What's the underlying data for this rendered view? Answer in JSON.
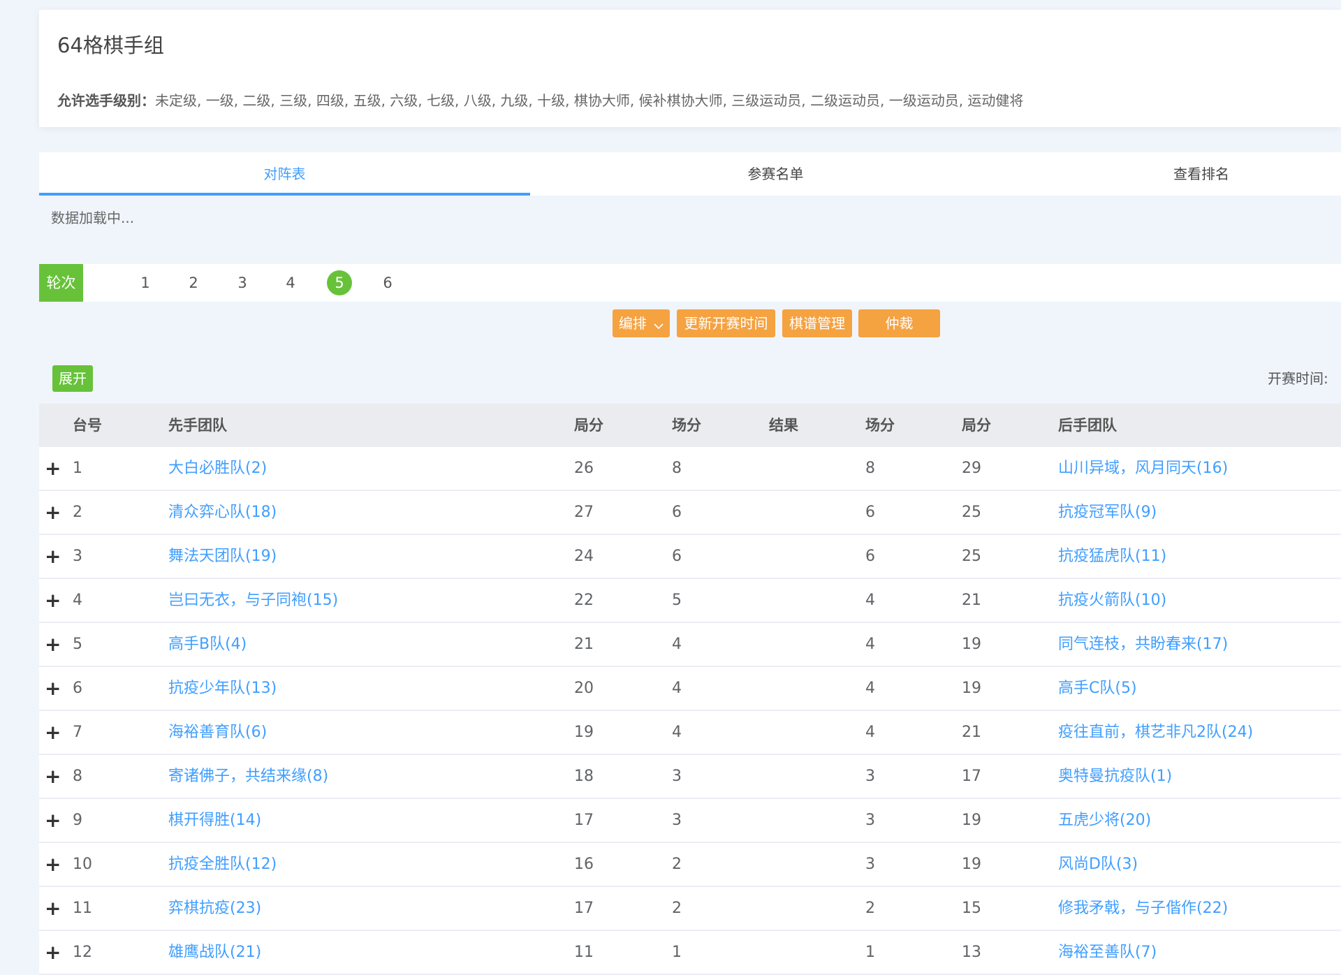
{
  "header": {
    "title": "64格棋手组",
    "grades_label": "允许选手级别：",
    "grades_value": "未定级, 一级, 二级, 三级, 四级, 五级, 六级, 七级, 八级, 九级, 十级, 棋协大师, 候补棋协大师, 三级运动员, 二级运动员, 一级运动员, 运动健将"
  },
  "tabs": [
    {
      "label": "对阵表",
      "active": true
    },
    {
      "label": "参赛名单",
      "active": false
    },
    {
      "label": "查看排名",
      "active": false
    }
  ],
  "loading_text": "数据加载中...",
  "rounds": {
    "label": "轮次",
    "items": [
      "1",
      "2",
      "3",
      "4",
      "5",
      "6"
    ],
    "active": "5"
  },
  "actions": {
    "arrange": "编排",
    "update_time": "更新开赛时间",
    "record_manage": "棋谱管理",
    "arbitrate": "仲裁"
  },
  "expand_label": "展开",
  "start_time_label": "开赛时间:",
  "table": {
    "headers": {
      "no": "台号",
      "home": "先手团队",
      "home_game_score": "局分",
      "home_match_score": "场分",
      "result": "结果",
      "away_match_score": "场分",
      "away_game_score": "局分",
      "away": "后手团队"
    },
    "rows": [
      {
        "no": "1",
        "home": "大白必胜队(2)",
        "hgs": "26",
        "hms": "8",
        "res": "",
        "ams": "8",
        "ags": "29",
        "away": "山川异域，风月同天(16)"
      },
      {
        "no": "2",
        "home": "清众弈心队(18)",
        "hgs": "27",
        "hms": "6",
        "res": "",
        "ams": "6",
        "ags": "25",
        "away": "抗疫冠军队(9)"
      },
      {
        "no": "3",
        "home": "舞法天团队(19)",
        "hgs": "24",
        "hms": "6",
        "res": "",
        "ams": "6",
        "ags": "25",
        "away": "抗疫猛虎队(11)"
      },
      {
        "no": "4",
        "home": "岂曰无衣，与子同袍(15)",
        "hgs": "22",
        "hms": "5",
        "res": "",
        "ams": "4",
        "ags": "21",
        "away": "抗疫火箭队(10)"
      },
      {
        "no": "5",
        "home": "高手B队(4)",
        "hgs": "21",
        "hms": "4",
        "res": "",
        "ams": "4",
        "ags": "19",
        "away": "同气连枝，共盼春来(17)"
      },
      {
        "no": "6",
        "home": "抗疫少年队(13)",
        "hgs": "20",
        "hms": "4",
        "res": "",
        "ams": "4",
        "ags": "19",
        "away": "高手C队(5)"
      },
      {
        "no": "7",
        "home": "海裕善育队(6)",
        "hgs": "19",
        "hms": "4",
        "res": "",
        "ams": "4",
        "ags": "21",
        "away": "疫往直前，棋艺非凡2队(24)"
      },
      {
        "no": "8",
        "home": "寄诸佛子，共结来缘(8)",
        "hgs": "18",
        "hms": "3",
        "res": "",
        "ams": "3",
        "ags": "17",
        "away": "奥特曼抗疫队(1)"
      },
      {
        "no": "9",
        "home": "棋开得胜(14)",
        "hgs": "17",
        "hms": "3",
        "res": "",
        "ams": "3",
        "ags": "19",
        "away": "五虎少将(20)"
      },
      {
        "no": "10",
        "home": "抗疫全胜队(12)",
        "hgs": "16",
        "hms": "2",
        "res": "",
        "ams": "3",
        "ags": "19",
        "away": "风尚D队(3)"
      },
      {
        "no": "11",
        "home": "弈棋抗疫(23)",
        "hgs": "17",
        "hms": "2",
        "res": "",
        "ams": "2",
        "ags": "15",
        "away": "修我矛戟，与子偕作(22)"
      },
      {
        "no": "12",
        "home": "雄鹰战队(21)",
        "hgs": "11",
        "hms": "1",
        "res": "",
        "ams": "1",
        "ags": "13",
        "away": "海裕至善队(7)"
      }
    ]
  },
  "colors": {
    "accent_blue": "#409eff",
    "green": "#67c23a",
    "orange": "#f5a241"
  }
}
